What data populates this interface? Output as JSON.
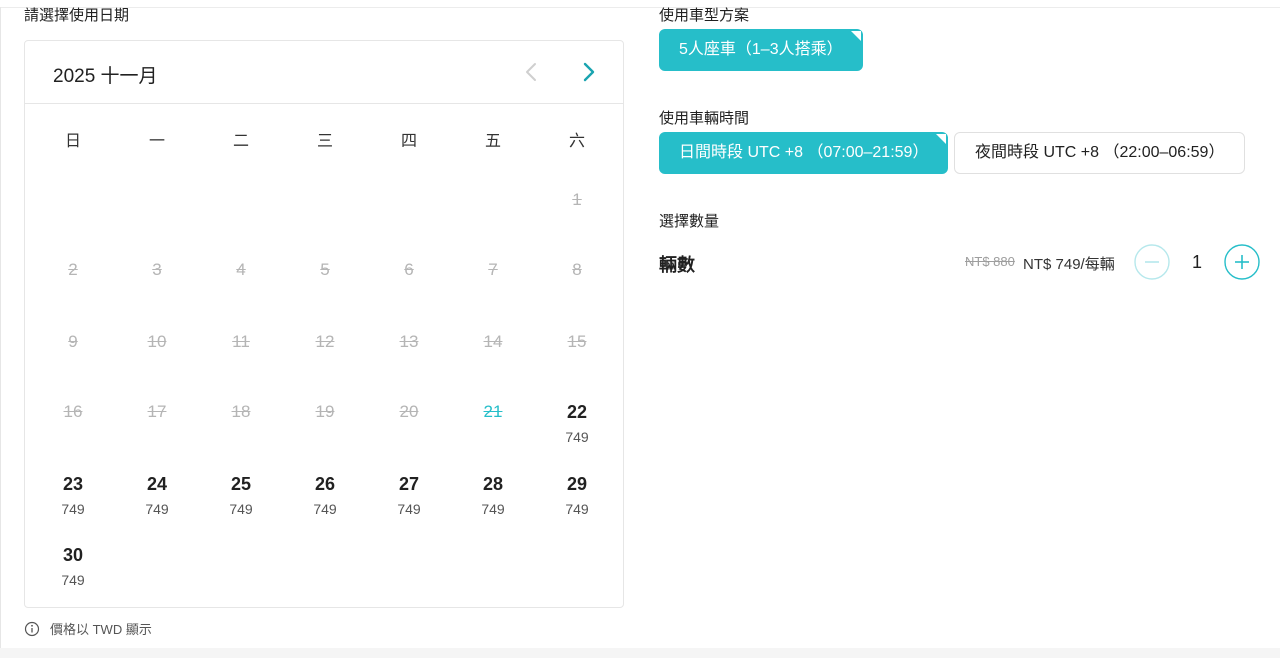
{
  "date_section": {
    "label": "請選擇使用日期"
  },
  "calendar": {
    "month_title": "2025 十一月",
    "weekdays": [
      "日",
      "一",
      "二",
      "三",
      "四",
      "五",
      "六"
    ],
    "days": [
      {
        "day": "1",
        "disabled": true
      },
      {
        "day": "2",
        "disabled": true
      },
      {
        "day": "3",
        "disabled": true
      },
      {
        "day": "4",
        "disabled": true
      },
      {
        "day": "5",
        "disabled": true
      },
      {
        "day": "6",
        "disabled": true
      },
      {
        "day": "7",
        "disabled": true
      },
      {
        "day": "8",
        "disabled": true
      },
      {
        "day": "9",
        "disabled": true
      },
      {
        "day": "10",
        "disabled": true
      },
      {
        "day": "11",
        "disabled": true
      },
      {
        "day": "12",
        "disabled": true
      },
      {
        "day": "13",
        "disabled": true
      },
      {
        "day": "14",
        "disabled": true
      },
      {
        "day": "15",
        "disabled": true
      },
      {
        "day": "16",
        "disabled": true
      },
      {
        "day": "17",
        "disabled": true
      },
      {
        "day": "18",
        "disabled": true
      },
      {
        "day": "19",
        "disabled": true
      },
      {
        "day": "20",
        "disabled": true
      },
      {
        "day": "21",
        "disabled": true,
        "today": true
      },
      {
        "day": "22",
        "price": "749"
      },
      {
        "day": "23",
        "price": "749"
      },
      {
        "day": "24",
        "price": "749"
      },
      {
        "day": "25",
        "price": "749"
      },
      {
        "day": "26",
        "price": "749"
      },
      {
        "day": "27",
        "price": "749"
      },
      {
        "day": "28",
        "price": "749"
      },
      {
        "day": "29",
        "price": "749"
      },
      {
        "day": "30",
        "price": "749"
      }
    ],
    "currency_note": "價格以 TWD 顯示"
  },
  "vehicle_type": {
    "label": "使用車型方案",
    "options": [
      {
        "label": "5人座車（1–3人搭乘）",
        "selected": true
      }
    ]
  },
  "vehicle_time": {
    "label": "使用車輛時間",
    "options": [
      {
        "label": "日間時段 UTC +8 （07:00–21:59）",
        "selected": true
      },
      {
        "label": "夜間時段 UTC +8 （22:00–06:59）",
        "selected": false
      }
    ]
  },
  "quantity": {
    "section_label": "選擇數量",
    "item_label": "輛數",
    "original_price": "NT$ 880",
    "price": "NT$ 749/每輛",
    "value": "1"
  },
  "colors": {
    "accent": "#26bec9",
    "disabled_text": "#b5b5b5"
  }
}
